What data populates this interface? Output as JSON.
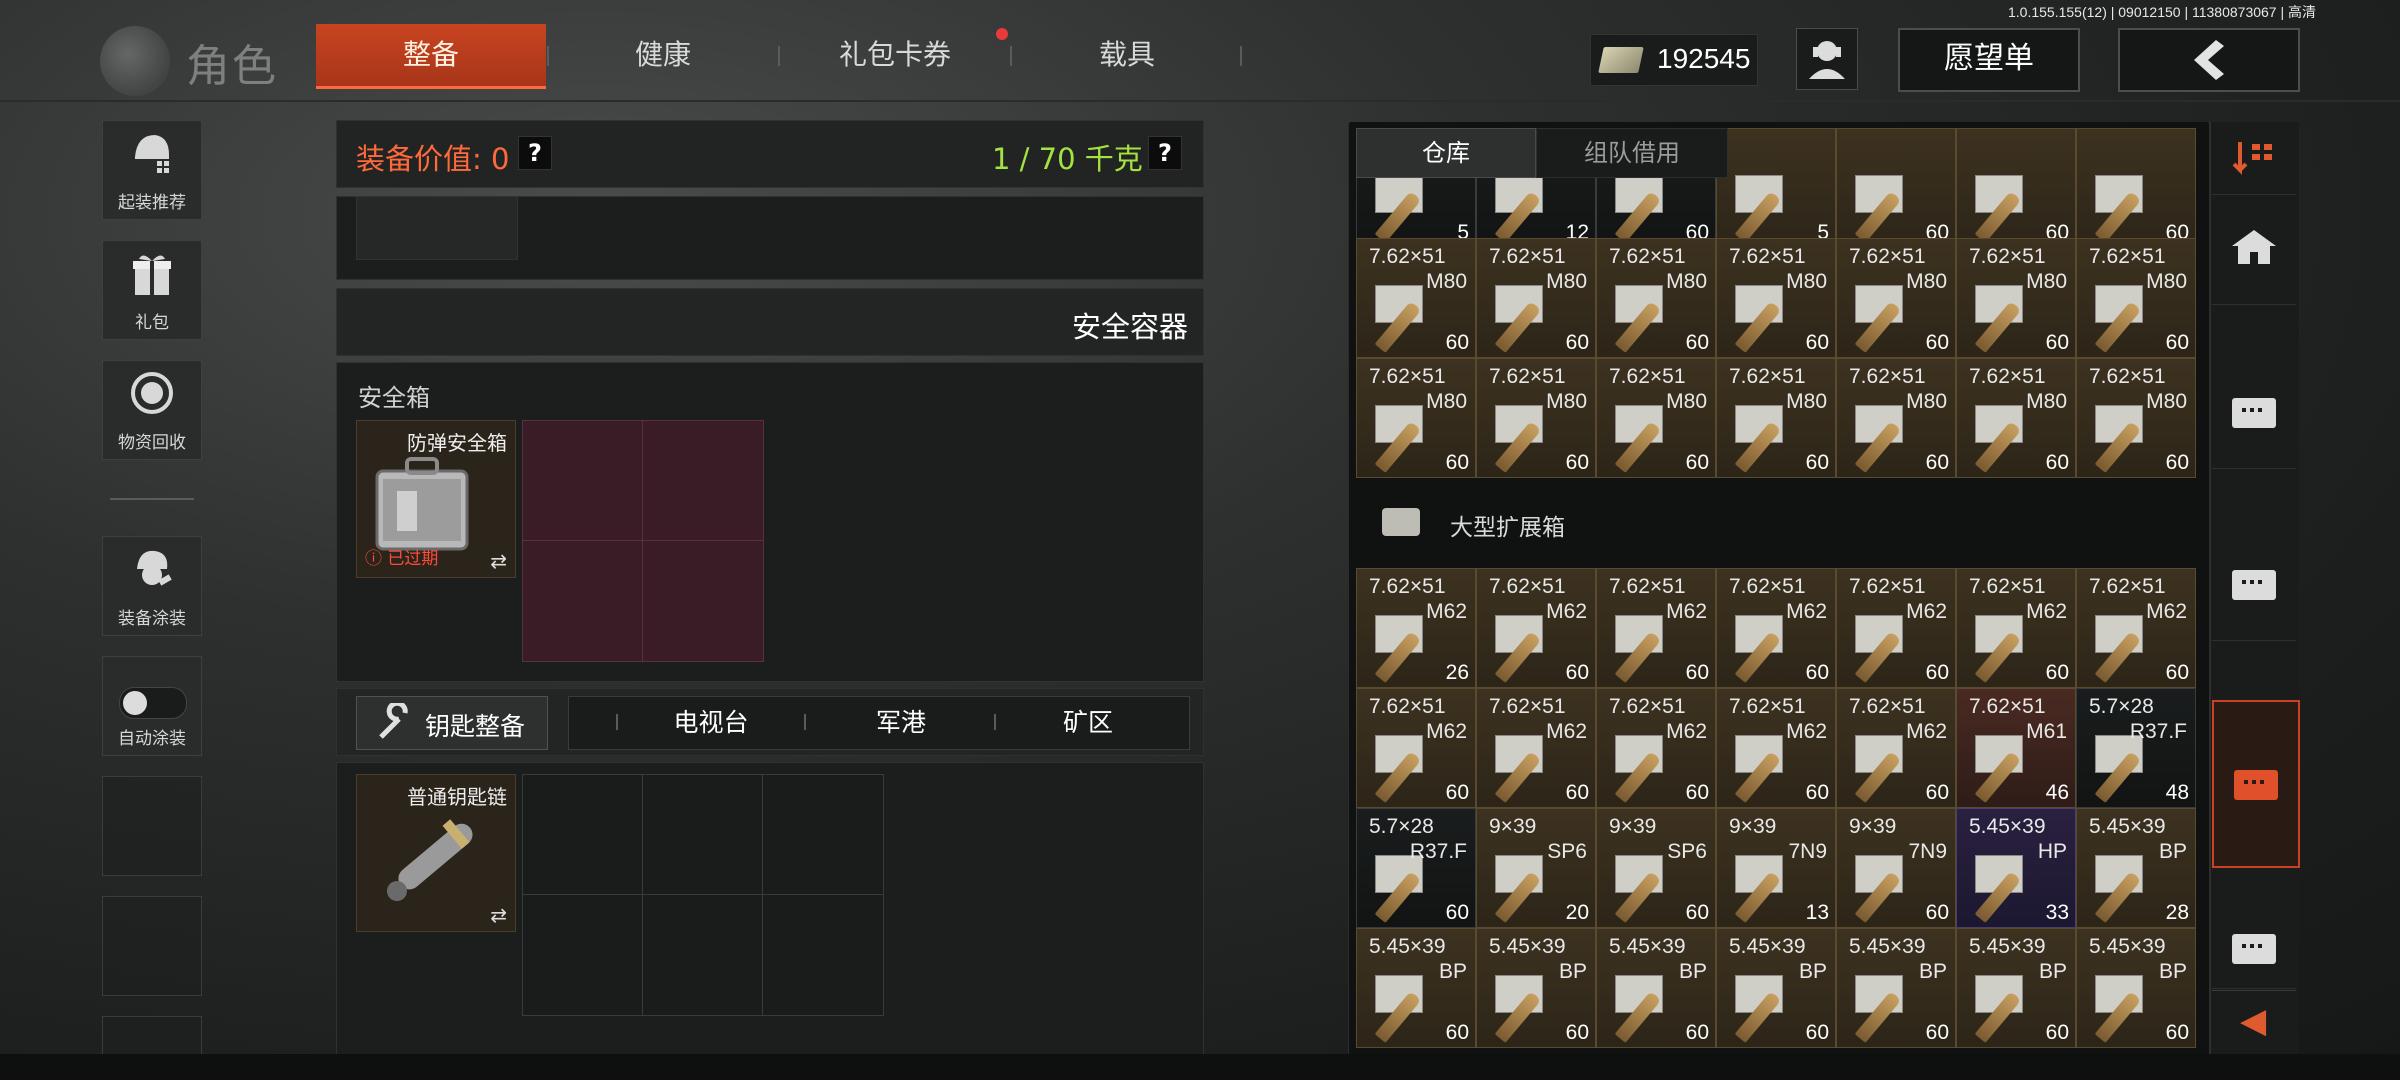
{
  "version": "1.0.155.155(12) | 09012150 | 11380873067 | 高清",
  "header": {
    "logo_text": "角色",
    "tabs": [
      {
        "label": "整备",
        "active": true
      },
      {
        "label": "健康",
        "active": false
      },
      {
        "label": "礼包卡券",
        "active": false,
        "badge": true
      },
      {
        "label": "载具",
        "active": false
      }
    ],
    "currency_value": "192545",
    "wishlist_label": "愿望单"
  },
  "sidebar": {
    "items": [
      {
        "label": "起装推荐",
        "icon": "helmet-recommend-icon"
      },
      {
        "label": "礼包",
        "icon": "gift-icon"
      },
      {
        "label": "物资回收",
        "icon": "recycle-icon"
      },
      {
        "label": "装备涂装",
        "icon": "paint-icon"
      },
      {
        "label": "自动涂装",
        "icon": "toggle-icon"
      }
    ]
  },
  "loadout": {
    "value_label": "装备价值: 0",
    "weight_label": "1 / 70 千克",
    "help_glyph": "?",
    "safe_container_title": "安全容器",
    "safe_box_label": "安全箱",
    "safe_box_item": {
      "name": "防弹安全箱",
      "status": "已过期",
      "swap": "⇄"
    },
    "key_section": {
      "button_label": "钥匙整备",
      "tabs": [
        "电视台",
        "军港",
        "矿区"
      ],
      "key_item": {
        "name": "普通钥匙链",
        "swap": "⇄"
      }
    }
  },
  "inventory": {
    "tabs": [
      {
        "label": "仓库",
        "active": true
      },
      {
        "label": "组队借用",
        "active": false
      }
    ],
    "top_partial_row": [
      {
        "qty": "5",
        "color": "dark"
      },
      {
        "qty": "12",
        "color": "dark"
      },
      {
        "qty": "60",
        "color": "dark"
      },
      {
        "qty": "5",
        "color": "gold"
      },
      {
        "qty": "60",
        "color": "gold"
      },
      {
        "qty": "60",
        "color": "gold"
      },
      {
        "qty": "60",
        "color": "gold"
      }
    ],
    "rows_a": [
      [
        {
          "cal": "7.62×51",
          "type": "M80",
          "qty": "60"
        },
        {
          "cal": "7.62×51",
          "type": "M80",
          "qty": "60"
        },
        {
          "cal": "7.62×51",
          "type": "M80",
          "qty": "60"
        },
        {
          "cal": "7.62×51",
          "type": "M80",
          "qty": "60"
        },
        {
          "cal": "7.62×51",
          "type": "M80",
          "qty": "60"
        },
        {
          "cal": "7.62×51",
          "type": "M80",
          "qty": "60"
        },
        {
          "cal": "7.62×51",
          "type": "M80",
          "qty": "60"
        }
      ],
      [
        {
          "cal": "7.62×51",
          "type": "M80",
          "qty": "60"
        },
        {
          "cal": "7.62×51",
          "type": "M80",
          "qty": "60"
        },
        {
          "cal": "7.62×51",
          "type": "M80",
          "qty": "60"
        },
        {
          "cal": "7.62×51",
          "type": "M80",
          "qty": "60"
        },
        {
          "cal": "7.62×51",
          "type": "M80",
          "qty": "60"
        },
        {
          "cal": "7.62×51",
          "type": "M80",
          "qty": "60"
        },
        {
          "cal": "7.62×51",
          "type": "M80",
          "qty": "60"
        }
      ]
    ],
    "section_label": "大型扩展箱",
    "rows_b": [
      [
        {
          "cal": "7.62×51",
          "type": "M62",
          "qty": "26"
        },
        {
          "cal": "7.62×51",
          "type": "M62",
          "qty": "60"
        },
        {
          "cal": "7.62×51",
          "type": "M62",
          "qty": "60"
        },
        {
          "cal": "7.62×51",
          "type": "M62",
          "qty": "60"
        },
        {
          "cal": "7.62×51",
          "type": "M62",
          "qty": "60"
        },
        {
          "cal": "7.62×51",
          "type": "M62",
          "qty": "60"
        },
        {
          "cal": "7.62×51",
          "type": "M62",
          "qty": "60"
        }
      ],
      [
        {
          "cal": "7.62×51",
          "type": "M62",
          "qty": "60"
        },
        {
          "cal": "7.62×51",
          "type": "M62",
          "qty": "60"
        },
        {
          "cal": "7.62×51",
          "type": "M62",
          "qty": "60"
        },
        {
          "cal": "7.62×51",
          "type": "M62",
          "qty": "60"
        },
        {
          "cal": "7.62×51",
          "type": "M62",
          "qty": "60"
        },
        {
          "cal": "7.62×51",
          "type": "M61",
          "qty": "46",
          "color": "red"
        },
        {
          "cal": "5.7×28",
          "type": "R37.F",
          "qty": "48",
          "color": "dark"
        }
      ],
      [
        {
          "cal": "5.7×28",
          "type": "R37.F",
          "qty": "60",
          "color": "dark"
        },
        {
          "cal": "9×39",
          "type": "SP6",
          "qty": "20"
        },
        {
          "cal": "9×39",
          "type": "SP6",
          "qty": "60"
        },
        {
          "cal": "9×39",
          "type": "7N9",
          "qty": "13"
        },
        {
          "cal": "9×39",
          "type": "7N9",
          "qty": "60"
        },
        {
          "cal": "5.45×39",
          "type": "HP",
          "qty": "33",
          "color": "purple"
        },
        {
          "cal": "5.45×39",
          "type": "BP",
          "qty": "28"
        }
      ],
      [
        {
          "cal": "5.45×39",
          "type": "BP",
          "qty": "60"
        },
        {
          "cal": "5.45×39",
          "type": "BP",
          "qty": "60"
        },
        {
          "cal": "5.45×39",
          "type": "BP",
          "qty": "60"
        },
        {
          "cal": "5.45×39",
          "type": "BP",
          "qty": "60"
        },
        {
          "cal": "5.45×39",
          "type": "BP",
          "qty": "60"
        },
        {
          "cal": "5.45×39",
          "type": "BP",
          "qty": "60"
        },
        {
          "cal": "5.45×39",
          "type": "BP",
          "qty": "60"
        }
      ]
    ]
  },
  "right_sidebar": {
    "items": [
      "sort-icon",
      "home-icon",
      "storage-box-icon",
      "storage-box-icon",
      "storage-box-active-icon",
      "storage-box-icon"
    ],
    "back": "◀"
  },
  "colors": {
    "accent": "#c84420",
    "weight": "#a4e240",
    "value": "#ff6a3a"
  }
}
